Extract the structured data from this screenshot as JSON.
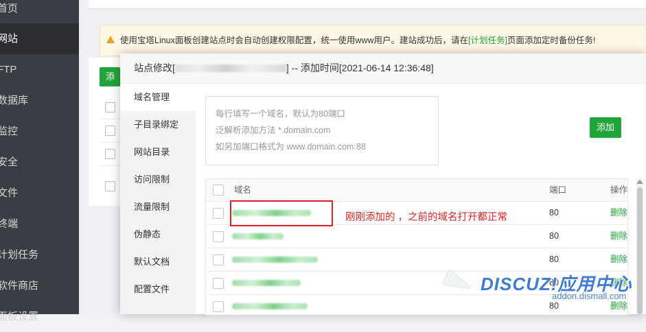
{
  "sidebar": {
    "items": [
      {
        "label": "首页",
        "active": false
      },
      {
        "label": "网站",
        "active": true
      },
      {
        "label": "FTP",
        "active": false
      },
      {
        "label": "数据库",
        "active": false
      },
      {
        "label": "监控",
        "active": false
      },
      {
        "label": "安全",
        "active": false
      },
      {
        "label": "文件",
        "active": false
      },
      {
        "label": "终端",
        "active": false
      },
      {
        "label": "计划任务",
        "active": false
      },
      {
        "label": "软件商店",
        "active": false
      },
      {
        "label": "面板设置",
        "active": false
      }
    ]
  },
  "notice": {
    "text_before": "使用宝塔Linux面板创建站点时会自动创建权限配置，统一使用www用户。建站成功后，请在",
    "link": "[计划任务]",
    "text_after": "页面添加定时备份任务!"
  },
  "background": {
    "add_label": "添加站点"
  },
  "dialog": {
    "title_prefix": "站点修改[",
    "title_suffix": "] -- 添加时间[2021-06-14 12:36:48]",
    "nav": [
      {
        "label": "域名管理",
        "active": true
      },
      {
        "label": "子目录绑定",
        "active": false
      },
      {
        "label": "网站目录",
        "active": false
      },
      {
        "label": "访问限制",
        "active": false
      },
      {
        "label": "流量限制",
        "active": false
      },
      {
        "label": "伪静态",
        "active": false
      },
      {
        "label": "默认文档",
        "active": false
      },
      {
        "label": "配置文件",
        "active": false
      }
    ],
    "textarea_placeholder": [
      "每行填写一个域名，默认为80端口",
      "泛解析添加方法 *.domain.com",
      "如另加端口格式为 www.domain.com:88"
    ],
    "add_button": "添加",
    "table": {
      "headers": {
        "domain": "域名",
        "port": "端口",
        "action": "操作"
      },
      "rows": [
        {
          "port": "80",
          "action": "删除"
        },
        {
          "port": "80",
          "action": "删除"
        },
        {
          "port": "80",
          "action": "删除"
        },
        {
          "port": "80",
          "action": "删除"
        },
        {
          "port": "80",
          "action": "删除"
        }
      ]
    }
  },
  "annotation": "刚刚添加的 ，之前的域名打开都正常",
  "watermark": {
    "logo": "DISCUZ!应用中心",
    "url": "addon.dismall.com"
  },
  "colors": {
    "accent": "#20a53a",
    "sidebar": "#3b3d44",
    "annotation": "#e02020"
  }
}
